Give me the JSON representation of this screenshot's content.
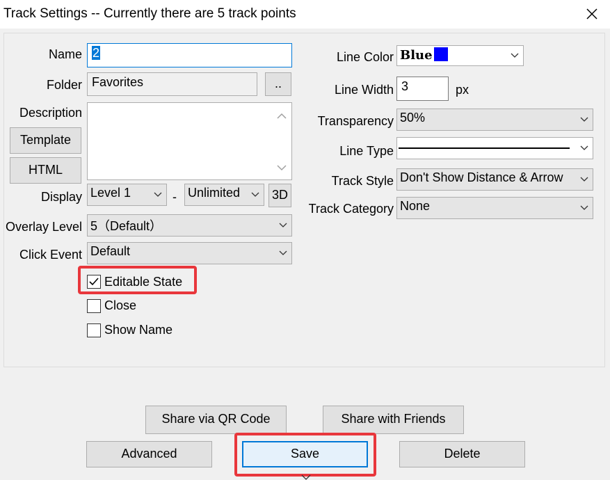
{
  "window": {
    "title": "Track Settings -- Currently there are 5 track points"
  },
  "left": {
    "name_label": "Name",
    "name_value": "2",
    "folder_label": "Folder",
    "folder_value": "Favorites",
    "folder_browse_label": "..",
    "description_label": "Description",
    "description_value": "",
    "template_button": "Template",
    "html_button": "HTML",
    "display_label": "Display",
    "display_from": "Level 1",
    "display_sep": "-",
    "display_to": "Unlimited",
    "threed_button": "3D",
    "overlay_label": "Overlay Level",
    "overlay_value": "5（Default）",
    "click_label": "Click Event",
    "click_value": "Default",
    "editable_label": "Editable State",
    "editable_checked": true,
    "close_label": "Close",
    "close_checked": false,
    "showname_label": "Show Name",
    "showname_checked": false
  },
  "right": {
    "line_color_label": "Line Color",
    "line_color_value": "Blue",
    "line_color_swatch": "#0000ff",
    "line_width_label": "Line Width",
    "line_width_value": "3",
    "line_width_unit": "px",
    "transparency_label": "Transparency",
    "transparency_value": "50%",
    "line_type_label": "Line Type",
    "track_style_label": "Track Style",
    "track_style_value": "Don't Show Distance & Arrow",
    "track_category_label": "Track Category",
    "track_category_value": "None"
  },
  "buttons": {
    "share_qr": "Share via QR Code",
    "share_friends": "Share with Friends",
    "advanced": "Advanced",
    "save": "Save",
    "delete": "Delete"
  },
  "colors": {
    "highlight": "#e8373c",
    "focus": "#0078d7"
  }
}
